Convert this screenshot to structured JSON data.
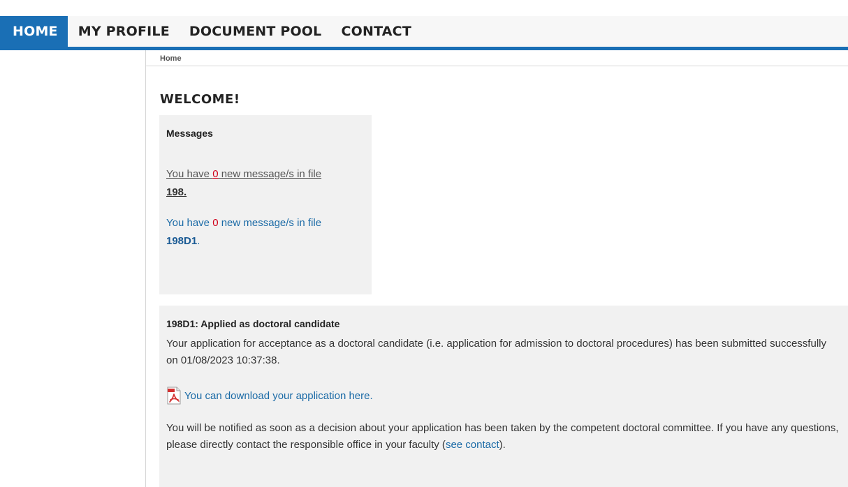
{
  "nav": {
    "items": [
      {
        "label": "HOME",
        "active": true
      },
      {
        "label": "MY PROFILE",
        "active": false
      },
      {
        "label": "DOCUMENT POOL",
        "active": false
      },
      {
        "label": "CONTACT",
        "active": false
      }
    ]
  },
  "breadcrumb": "Home",
  "page_title": "WELCOME!",
  "messages": {
    "heading": "Messages",
    "lines": [
      {
        "prefix": "You have ",
        "count": "0",
        "suffix": " new message/s in file",
        "file": "198.",
        "trailing": ""
      },
      {
        "prefix": "You have ",
        "count": "0",
        "suffix": " new message/s in file",
        "file": "198D1",
        "trailing": "."
      }
    ]
  },
  "status": {
    "heading": "198D1: Applied as doctoral candidate",
    "paragraph1": "Your application for acceptance as a doctoral candidate (i.e. application for admission to doctoral procedures) has been submitted successfully on 01/08/2023 10:37:38.",
    "download_icon": "pdf-icon",
    "download_label": "You can download your application here.",
    "paragraph2_before": "You will be notified as soon as a decision about your application has been taken by the competent doctoral committee. If you have any questions, please directly contact the responsible office in your faculty (",
    "paragraph2_link": "see contact",
    "paragraph2_after": ")."
  },
  "colors": {
    "accent": "#1a6fb5",
    "link": "#1a6aa6",
    "count_red": "#d0021b",
    "panel_bg": "#f1f1f1"
  }
}
